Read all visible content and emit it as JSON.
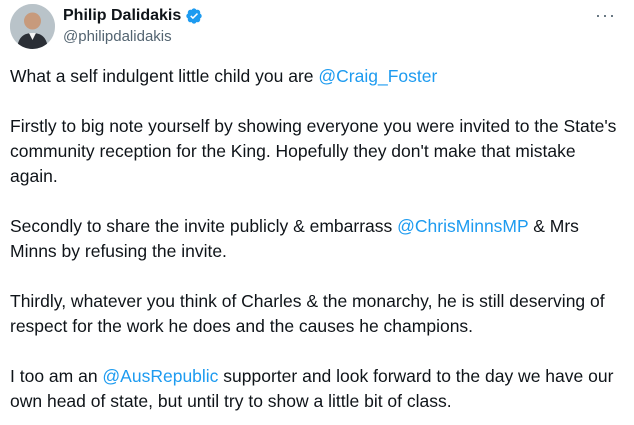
{
  "author": {
    "display_name": "Philip Dalidakis",
    "handle": "@philipdalidakis",
    "verified": true
  },
  "menu": {
    "more_icon": "more-horizontal-icon",
    "more_glyph": "···"
  },
  "colors": {
    "mention": "#1d9bf0",
    "verified_badge": "#1d9bf0"
  },
  "tweet": {
    "paragraphs": [
      {
        "parts": [
          {
            "text": "What a self indulgent little child you are "
          },
          {
            "text": "@Craig_Foster",
            "mention": true
          }
        ]
      },
      {
        "parts": [
          {
            "text": "Firstly to big note yourself by showing everyone you were invited to the State's community reception for the King. Hopefully they don't make that mistake again."
          }
        ]
      },
      {
        "parts": [
          {
            "text": "Secondly to share the invite publicly & embarrass "
          },
          {
            "text": "@ChrisMinnsMP",
            "mention": true
          },
          {
            "text": " & Mrs Minns by refusing the invite."
          }
        ]
      },
      {
        "parts": [
          {
            "text": "Thirdly, whatever you think of Charles & the monarchy, he is still deserving of respect for the work he does and the causes he champions."
          }
        ]
      },
      {
        "parts": [
          {
            "text": "I too am an "
          },
          {
            "text": "@AusRepublic",
            "mention": true
          },
          {
            "text": " supporter and look forward to the day we have our own head of state, but until try to show a little bit of class."
          }
        ]
      }
    ]
  }
}
